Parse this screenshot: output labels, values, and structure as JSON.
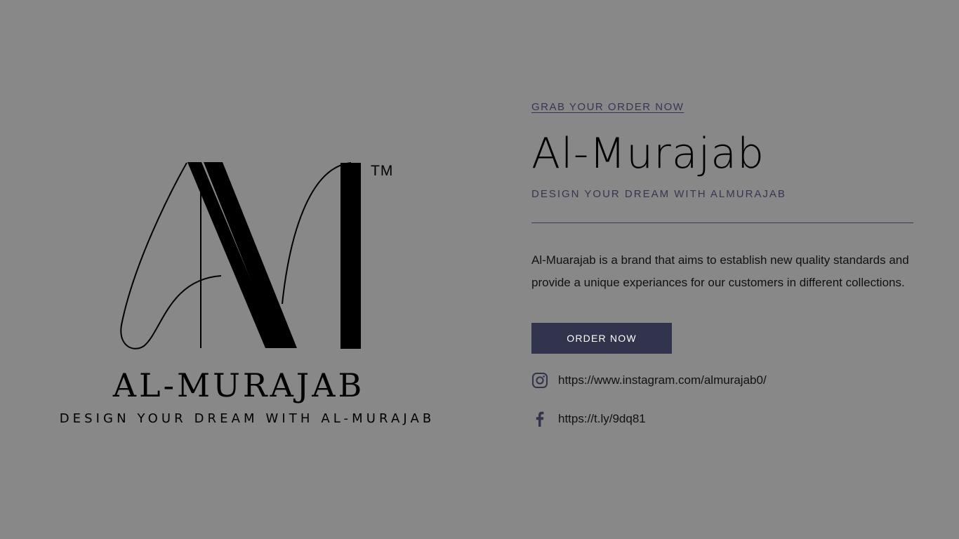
{
  "logo": {
    "trademark": "TM",
    "wordmark": "AL-MURAJAB",
    "tagline": "DESIGN YOUR DREAM WITH AL-MURAJAB"
  },
  "hero": {
    "eyebrow_link": "GRAB YOUR ORDER NOW",
    "title": "Al-Murajab",
    "subtitle": "DESIGN YOUR DREAM WITH ALMURAJAB",
    "description": "Al-Muarajab is a brand that aims to establish new quality standards and provide a unique experiances for our customers in different collections.",
    "order_button": "ORDER NOW"
  },
  "social": [
    {
      "icon": "instagram-icon",
      "url": "https://www.instagram.com/almurajab0/"
    },
    {
      "icon": "facebook-icon",
      "url": "https://t.ly/9dq81"
    }
  ],
  "colors": {
    "background": "#888888",
    "accent": "#32334d",
    "text": "#111111",
    "muted_text": "#363652"
  }
}
